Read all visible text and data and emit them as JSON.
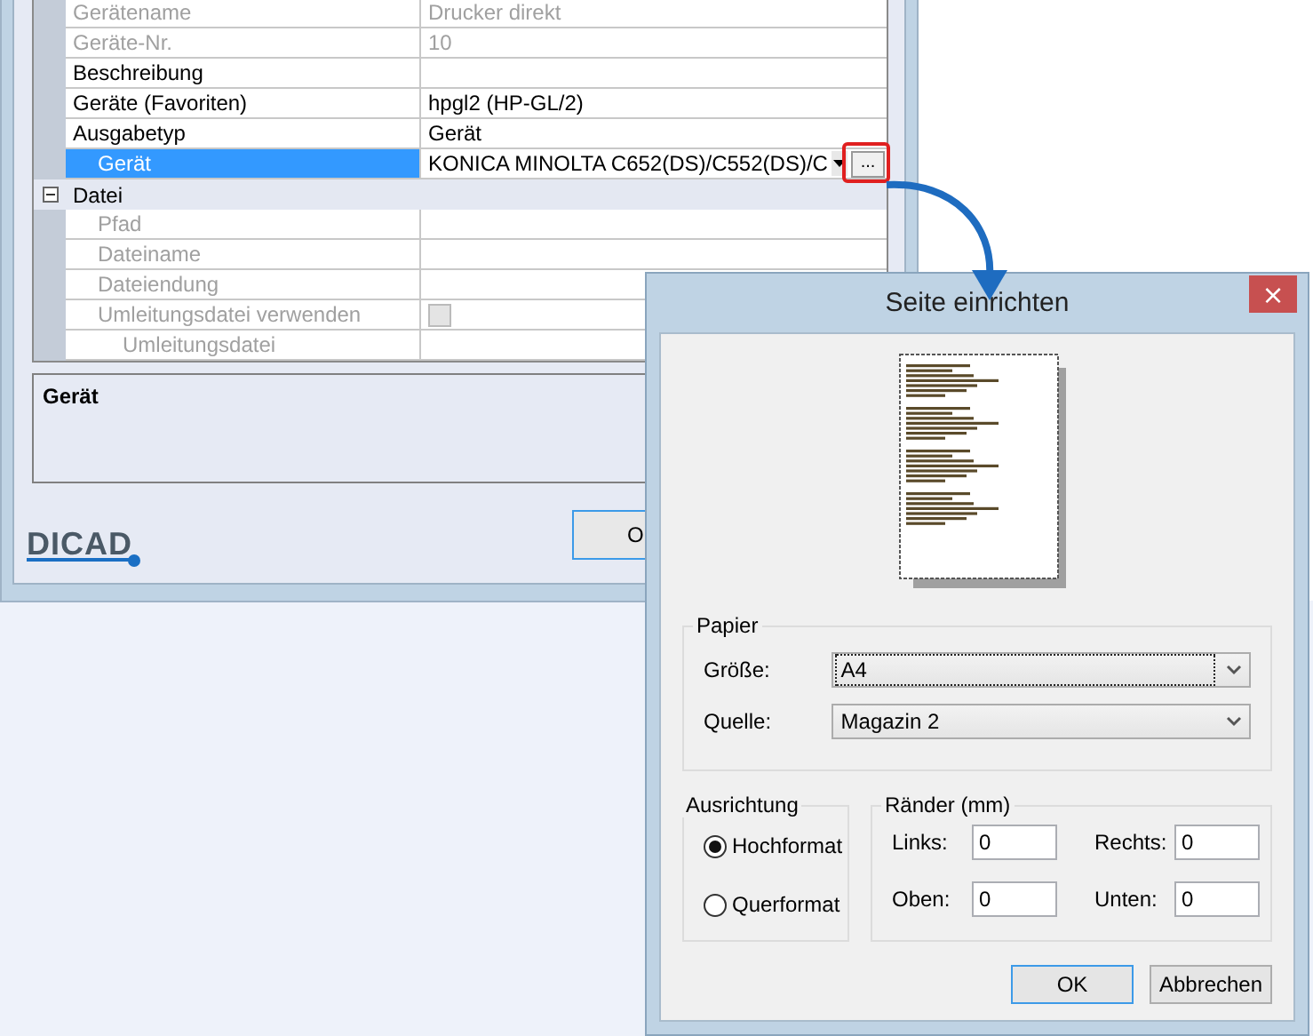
{
  "background_window": {
    "property_grid": {
      "rows": [
        {
          "kind": "property",
          "label": "Gerätename",
          "value": "Drucker direkt",
          "disabled": true,
          "selected": false
        },
        {
          "kind": "property",
          "label": "Geräte-Nr.",
          "value": "10",
          "disabled": true,
          "selected": false
        },
        {
          "kind": "property",
          "label": "Beschreibung",
          "disabled": false,
          "selected": false
        },
        {
          "kind": "property",
          "label": "Geräte (Favoriten)",
          "value": "hpgl2 (HP-GL/2)",
          "disabled": false,
          "selected": false
        },
        {
          "kind": "property",
          "label": "Ausgabetyp",
          "value": "Gerät",
          "disabled": false,
          "selected": false,
          "children": [
            {
              "kind": "dropdown",
              "label": "Gerät",
              "value": "KONICA MINOLTA C652(DS)/C552(DS)/C",
              "disabled": false,
              "selected": true,
              "ellipsis_button": {
                "label": "...",
                "highlighted": true
              }
            }
          ]
        },
        {
          "kind": "category",
          "label": "Datei",
          "expanded": true,
          "children": [
            {
              "kind": "property",
              "label": "Pfad",
              "disabled": true,
              "selected": false
            },
            {
              "kind": "property",
              "label": "Dateiname",
              "disabled": true,
              "selected": false
            },
            {
              "kind": "property",
              "label": "Dateiendung",
              "disabled": true,
              "selected": false
            },
            {
              "kind": "checkbox",
              "label": "Umleitungsdatei verwenden",
              "checked": false,
              "disabled": true,
              "selected": false,
              "children": [
                {
                  "kind": "property",
                  "label": "Umleitungsdatei",
                  "disabled": true,
                  "selected": false
                }
              ]
            }
          ]
        }
      ]
    },
    "description": {
      "title": "Gerät"
    },
    "logo": "DICAD",
    "button": "O"
  },
  "dialog": {
    "title": "Seite einrichten",
    "close": "×",
    "paper": {
      "title": "Papier",
      "fields": [
        {
          "label": "Größe:",
          "value": "A4",
          "focused": true
        },
        {
          "label": "Quelle:",
          "value": "Magazin 2",
          "focused": false
        }
      ]
    },
    "orientation": {
      "title": "Ausrichtung",
      "options": [
        {
          "label": "Hochformat",
          "selected": true
        },
        {
          "label": "Querformat",
          "selected": false
        }
      ]
    },
    "margins": {
      "title": "Ränder (mm)",
      "fields": [
        {
          "label": "Links:",
          "value": "0"
        },
        {
          "label": "Rechts:",
          "value": "0"
        },
        {
          "label": "Oben:",
          "value": "0"
        },
        {
          "label": "Unten:",
          "value": "0"
        }
      ]
    },
    "buttons": [
      {
        "label": "OK",
        "default": true
      },
      {
        "label": "Abbrechen",
        "default": false
      }
    ]
  }
}
